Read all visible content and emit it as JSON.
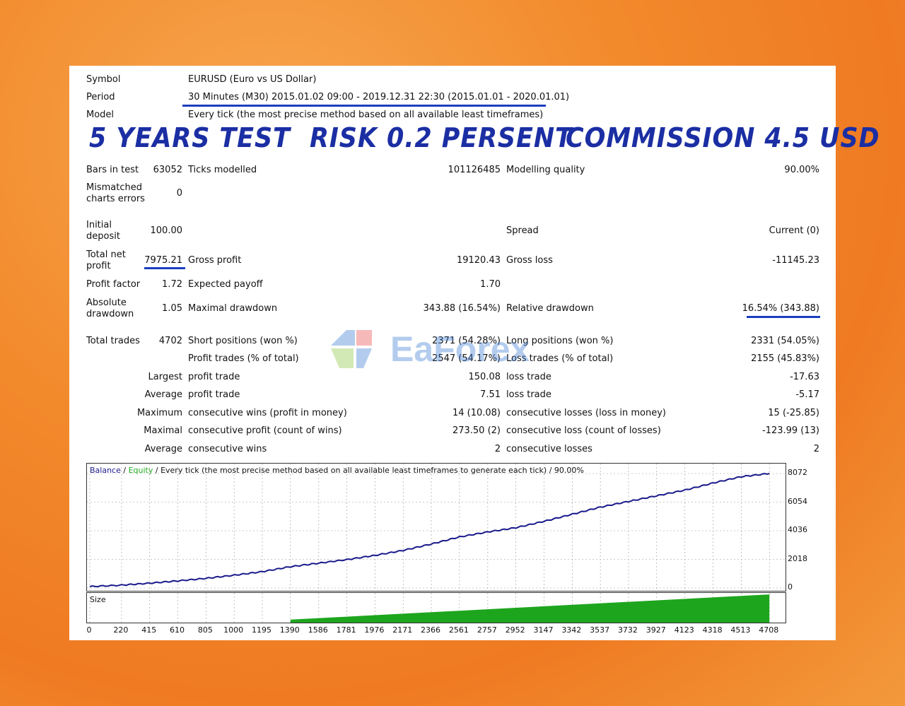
{
  "header": {
    "symbol_label": "Symbol",
    "symbol_value": "EURUSD (Euro vs US Dollar)",
    "period_label": "Period",
    "period_value": "30 Minutes (M30) 2015.01.02 09:00 - 2019.12.31 22:30 (2015.01.01 - 2020.01.01)",
    "model_label": "Model",
    "model_value": "Every tick (the most precise method based on all available least timeframes)"
  },
  "banner": {
    "years": "5 YEARS TEST",
    "risk": "RISK 0.2 PERSENT",
    "commission": "COMMISSION 4.5 USD"
  },
  "stats": {
    "bars_label": "Bars in test",
    "bars_value": "63052",
    "ticks_label": "Ticks modelled",
    "ticks_value": "101126485",
    "quality_label": "Modelling quality",
    "quality_value": "90.00%",
    "mismatch_label": "Mismatched charts errors",
    "mismatch_value": "0",
    "deposit_label": "Initial deposit",
    "deposit_value": "100.00",
    "spread_label": "Spread",
    "spread_value": "Current (0)",
    "netprofit_label": "Total net profit",
    "netprofit_value": "7975.21",
    "grossprofit_label": "Gross profit",
    "grossprofit_value": "19120.43",
    "grossloss_label": "Gross loss",
    "grossloss_value": "-11145.23",
    "pf_label": "Profit factor",
    "pf_value": "1.72",
    "payoff_label": "Expected payoff",
    "payoff_value": "1.70",
    "absdd_label": "Absolute drawdown",
    "absdd_value": "1.05",
    "maxdd_label": "Maximal drawdown",
    "maxdd_value": "343.88 (16.54%)",
    "reldd_label": "Relative drawdown",
    "reldd_value": "16.54% (343.88)",
    "trades_label": "Total trades",
    "trades_value": "4702",
    "short_label": "Short positions (won %)",
    "short_value": "2371 (54.28%)",
    "long_label": "Long positions (won %)",
    "long_value": "2331 (54.05%)",
    "ptrades_label": "Profit trades (% of total)",
    "ptrades_value": "2547 (54.17%)",
    "ltrades_label": "Loss trades (% of total)",
    "ltrades_value": "2155 (45.83%)",
    "largest_label": "Largest",
    "largest_profit_label": "profit trade",
    "largest_profit_value": "150.08",
    "largest_loss_label": "loss trade",
    "largest_loss_value": "-17.63",
    "average_label": "Average",
    "average_profit_label": "profit trade",
    "average_profit_value": "7.51",
    "average_loss_label": "loss trade",
    "average_loss_value": "-5.17",
    "maximum_label": "Maximum",
    "max_wins_label": "consecutive wins (profit in money)",
    "max_wins_value": "14 (10.08)",
    "max_losses_label": "consecutive losses (loss in money)",
    "max_losses_value": "15 (-25.85)",
    "maximal_label": "Maximal",
    "maximal_profit_label": "consecutive profit (count of wins)",
    "maximal_profit_value": "273.50 (2)",
    "maximal_loss_label": "consecutive loss (count of losses)",
    "maximal_loss_value": "-123.99 (13)",
    "avg_consec_label": "Average",
    "avg_wins_label": "consecutive wins",
    "avg_wins_value": "2",
    "avg_losses_label": "consecutive losses",
    "avg_losses_value": "2"
  },
  "watermark": {
    "text": "EaForex"
  },
  "chart_legend": {
    "balance": "Balance",
    "sep1": " / ",
    "equity": "Equity",
    "rest": " / Every tick (the most precise method based on all available least timeframes to generate each tick) / 90.00%"
  },
  "size_label": "Size",
  "colors": {
    "balance": "#1a1a8c",
    "equity": "#22aa22",
    "size": "#1ea51e",
    "underline": "#1c3fbf",
    "banner": "#1b2ea3"
  },
  "chart_data": {
    "type": "line",
    "series": [
      {
        "name": "Balance",
        "x": [
          0,
          220,
          415,
          610,
          805,
          1000,
          1195,
          1390,
          1586,
          1781,
          1976,
          2171,
          2366,
          2561,
          2757,
          2952,
          3147,
          3342,
          3537,
          3732,
          3927,
          4123,
          4318,
          4513,
          4708
        ],
        "values": [
          100,
          200,
          340,
          500,
          680,
          900,
          1150,
          1500,
          1750,
          2000,
          2300,
          2650,
          3100,
          3600,
          3950,
          4250,
          4700,
          5200,
          5700,
          6100,
          6500,
          6900,
          7400,
          7850,
          8072
        ]
      }
    ],
    "xticks": [
      0,
      220,
      415,
      610,
      805,
      1000,
      1195,
      1390,
      1586,
      1781,
      1976,
      2171,
      2366,
      2561,
      2757,
      2952,
      3147,
      3342,
      3537,
      3732,
      3927,
      4123,
      4318,
      4513,
      4708
    ],
    "yticks": [
      0,
      2018,
      4036,
      6054,
      8072
    ],
    "ylim": [
      0,
      8400
    ],
    "xlim": [
      0,
      4800
    ],
    "grid": true,
    "size_series": {
      "name": "Size",
      "start_x": 1390,
      "end_x": 4708,
      "start_fraction": 0.1,
      "end_fraction": 0.95
    }
  }
}
